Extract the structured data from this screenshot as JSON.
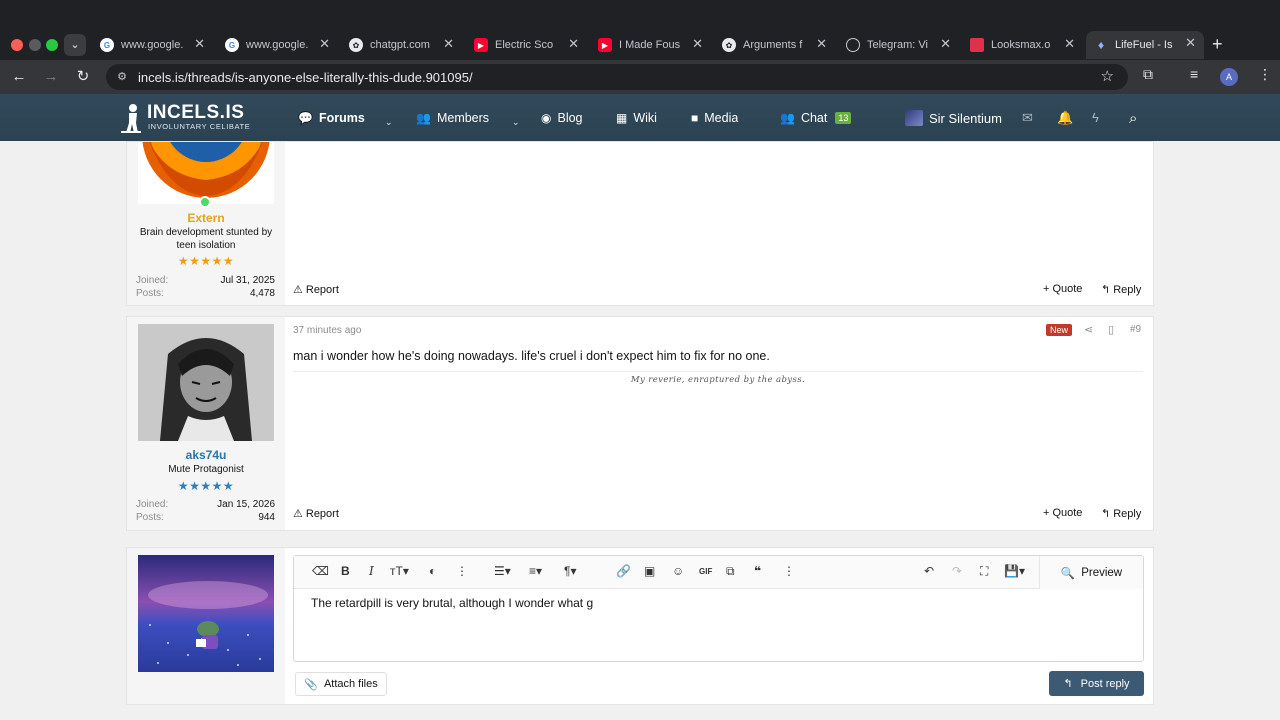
{
  "browser": {
    "tabs": [
      {
        "title": "www.google.",
        "icon": "google-icon",
        "color": "#ffffff"
      },
      {
        "title": "www.google.",
        "icon": "google-icon",
        "color": "#ffffff"
      },
      {
        "title": "chatgpt.com",
        "icon": "openai-icon",
        "color": "#e8eaed"
      },
      {
        "title": "Electric Sco",
        "icon": "youtube-icon",
        "color": "#ff0033"
      },
      {
        "title": "I Made Fous",
        "icon": "youtube-icon",
        "color": "#ff0033"
      },
      {
        "title": "Arguments f",
        "icon": "openai-icon",
        "color": "#e8eaed"
      },
      {
        "title": "Telegram: Vi",
        "icon": "globe-icon",
        "color": "#c4c7cc"
      },
      {
        "title": "Looksmax.o",
        "icon": "looksmax-icon",
        "color": "#e0314b"
      },
      {
        "title": "LifeFuel - Is",
        "icon": "incels-icon",
        "color": "#8ab4f8"
      }
    ],
    "url": "incels.is/threads/is-anyone-else-literally-this-dude.901095/",
    "profile_initial": "A",
    "new_tab": "+"
  },
  "site": {
    "logo_title": "INCELS.IS",
    "logo_subtitle": "INVOLUNTARY CELIBATE",
    "nav": {
      "forums": "Forums",
      "members": "Members",
      "blog": "Blog",
      "wiki": "Wiki",
      "media": "Media",
      "chat": "Chat",
      "chat_count": "13"
    },
    "username": "Sir Silentium"
  },
  "posts": [
    {
      "username": "Extern",
      "user_color": "#e8a317",
      "user_title": "Brain development stunted by teen isolation",
      "stars": "★★★★★",
      "star_color": "#f39c12",
      "joined_label": "Joined:",
      "joined": "Jul 31, 2025",
      "posts_label": "Posts:",
      "posts_count": "4,478",
      "report": "Report",
      "quote": "Quote",
      "reply": "Reply"
    },
    {
      "time": "37 minutes ago",
      "new_badge": "New",
      "post_number": "#9",
      "text": "man i wonder how he's doing nowadays. life's cruel i don't expect him to fix for no one.",
      "signature": "My reverie, enraptured by the abyss.",
      "username": "aks74u",
      "user_color": "#2577b1",
      "user_title": "Mute Protagonist",
      "stars": "★★★★★",
      "star_color": "#2e7fc0",
      "joined_label": "Joined:",
      "joined": "Jan 15, 2026",
      "posts_label": "Posts:",
      "posts_count": "944",
      "report": "Report",
      "quote": "Quote",
      "reply": "Reply"
    }
  ],
  "editor": {
    "draft_text": "The retardpill is very brutal, although I wonder what g",
    "preview": "Preview",
    "attach": "Attach files",
    "post_reply": "Post reply"
  }
}
